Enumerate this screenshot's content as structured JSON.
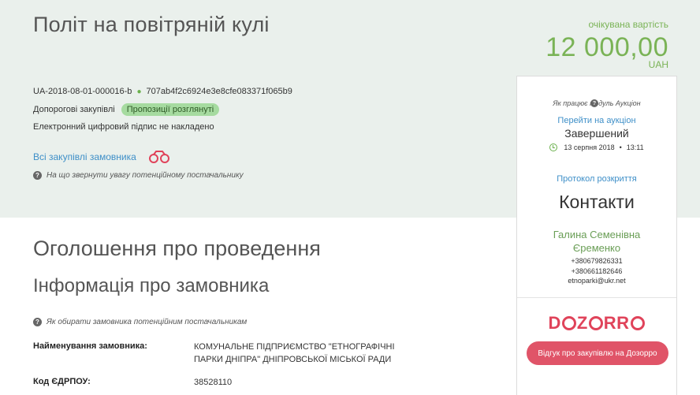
{
  "tender": {
    "title": "Політ на повітряній кулі",
    "price_label": "очікувана вартість",
    "price_value": "12 000,00",
    "currency": "UAH",
    "id": "UA-2018-08-01-000016-b",
    "hash": "707ab4f2c6924e3e8cfe083371f065b9",
    "procedure": "Допорогові закупівлі",
    "status": "Пропозиції розглянуті",
    "signature": "Електронний цифровий підпис не накладено",
    "all_tenders_link": "Всі закупівлі замовника",
    "supplier_hint": "На що звернути увагу потенційному постачальнику"
  },
  "sections": {
    "announcement": "Оголошення про проведення",
    "customer_info": "Інформація про замовника",
    "customer_hint": "Як обирати замовника потенційним постачальникам"
  },
  "fields": {
    "name_label": "Найменування замовника:",
    "name_value": "КОМУНАЛЬНЕ ПІДПРИЄМСТВО \"ЕТНОГРАФІЧНІ ПАРКИ ДНІПРА\" ДНІПРОВСЬКОЇ МІСЬКОЇ РАДИ",
    "code_label": "Код ЄДРПОУ:",
    "code_value": "38528110"
  },
  "sidebar": {
    "auction_help": "Як працює модуль Аукціон",
    "go_auction": "Перейти на аукціон",
    "auction_state": "Завершений",
    "auction_date": "13 серпня 2018",
    "auction_time": "13:11",
    "protocol": "Протокол розкриття",
    "contacts_title": "Контакти",
    "contact_name": "Галина Семенівна Єременко",
    "phone1": "+380679826331",
    "phone2": "+380661182646",
    "email": "etnoparki@ukr.net",
    "dozorro_button": "Відгук про закупівлю на Дозорро"
  },
  "colors": {
    "accent_green": "#7ab356",
    "link_blue": "#3e8fc8",
    "dozorro_red": "#e0435a",
    "band": "#eaf0ec"
  }
}
